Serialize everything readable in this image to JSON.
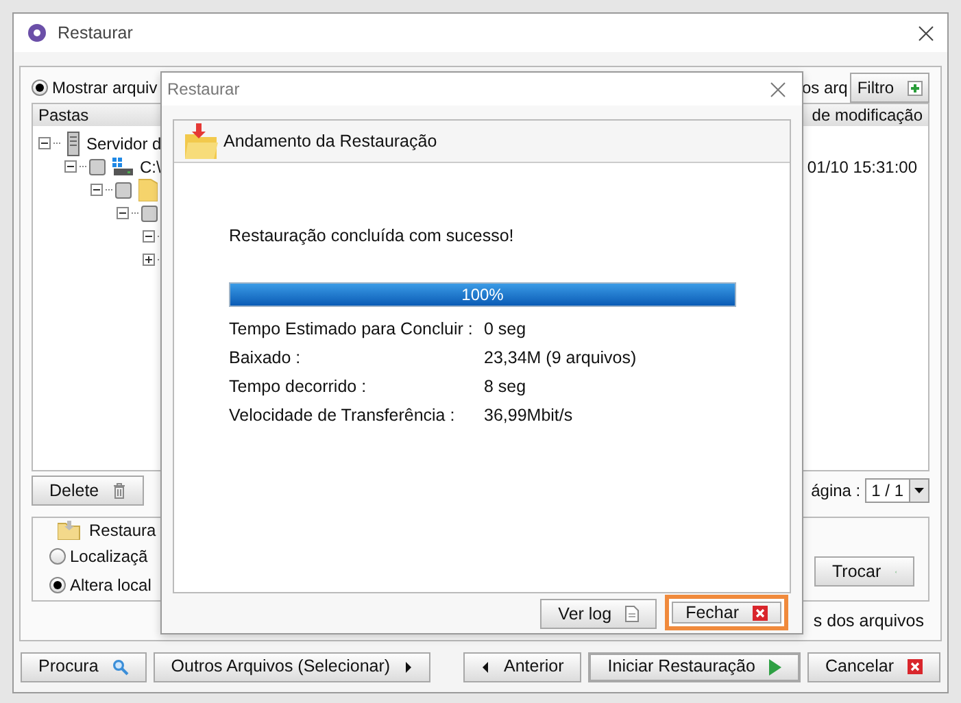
{
  "window": {
    "title": "Restaurar"
  },
  "show_option": {
    "label": "Mostrar arquiv",
    "selected": true
  },
  "filter_text": "os arq",
  "filter_button": {
    "label": "Filtro"
  },
  "folders_panel": {
    "columns": [
      "Pastas",
      "de modificação"
    ],
    "tree": [
      {
        "label": "Servidor d",
        "expanded": true,
        "children": [
          {
            "label": "C:\\",
            "checked": false,
            "expanded": true,
            "children": [
              {
                "checked": false,
                "expanded": true,
                "children": [
                  {
                    "checked": false,
                    "expanded": true,
                    "children": [
                      {
                        "expanded": true
                      },
                      {
                        "expanded": false
                      }
                    ]
                  }
                ]
              }
            ]
          }
        ]
      }
    ],
    "date": "01/10 15:31:00"
  },
  "delete_button": {
    "label": "Delete"
  },
  "page": {
    "label": "ágina :",
    "value": "1 / 1"
  },
  "restore_group": {
    "title": "Restaura",
    "options": [
      {
        "label": "Localizaçã",
        "selected": false
      },
      {
        "label": "Altera local",
        "selected": true
      }
    ],
    "change_button": {
      "label": "Trocar"
    }
  },
  "files_note": "s dos arquivos",
  "footer_left": [
    {
      "label": "Procura",
      "default": false
    },
    {
      "label": "Outros Arquivos (Selecionar)",
      "default": false
    }
  ],
  "footer_right": [
    {
      "label": "Anterior",
      "default": false
    },
    {
      "label": "Iniciar Restauração",
      "default": true
    },
    {
      "label": "Cancelar",
      "default": false
    }
  ],
  "dialog": {
    "title": "Restaurar",
    "heading": "Andamento da Restauração",
    "message": "Restauração concluída com sucesso!",
    "progress": {
      "level": 1,
      "text": "100%"
    },
    "stats": [
      {
        "label": "Tempo Estimado para Concluir :",
        "value": "0 seg"
      },
      {
        "label": "Baixado :",
        "value": "23,34M (9 arquivos)"
      },
      {
        "label": "Tempo decorrido :",
        "value": "8 seg"
      },
      {
        "label": "Velocidade de Transferência :",
        "value": "36,99Mbit/s"
      }
    ],
    "buttons": [
      {
        "label": "Ver log",
        "focused": false
      },
      {
        "label": "Fechar",
        "focused": true
      }
    ]
  }
}
